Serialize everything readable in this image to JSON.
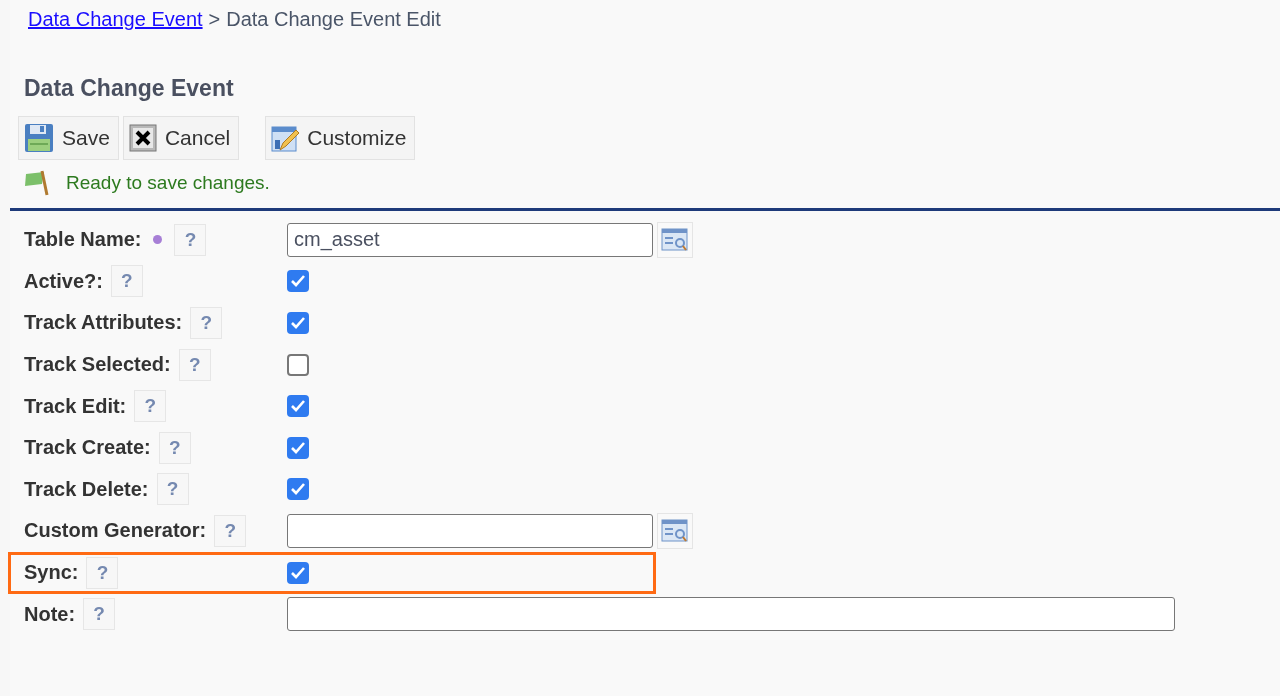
{
  "breadcrumb": {
    "link": "Data Change Event",
    "separator": ">",
    "current": "Data Change Event Edit"
  },
  "heading": "Data Change Event",
  "toolbar": [
    {
      "label": "Save",
      "kind": "save"
    },
    {
      "label": "Cancel",
      "kind": "cancel"
    },
    {
      "label": "Customize",
      "kind": "customize"
    }
  ],
  "status_message": "Ready to save changes.",
  "fields": [
    {
      "label": "Table Name:",
      "help": "?",
      "required": true,
      "kind": "text",
      "value": "cm_asset",
      "lookup": true,
      "highlighted": false
    },
    {
      "label": "Active?:",
      "help": "?",
      "required": false,
      "kind": "checkbox",
      "checked": true,
      "highlighted": false
    },
    {
      "label": "Track Attributes:",
      "help": "?",
      "required": false,
      "kind": "checkbox",
      "checked": true,
      "highlighted": false
    },
    {
      "label": "Track Selected:",
      "help": "?",
      "required": false,
      "kind": "checkbox",
      "checked": false,
      "highlighted": false
    },
    {
      "label": "Track Edit:",
      "help": "?",
      "required": false,
      "kind": "checkbox",
      "checked": true,
      "highlighted": false
    },
    {
      "label": "Track Create:",
      "help": "?",
      "required": false,
      "kind": "checkbox",
      "checked": true,
      "highlighted": false
    },
    {
      "label": "Track Delete:",
      "help": "?",
      "required": false,
      "kind": "checkbox",
      "checked": true,
      "highlighted": false
    },
    {
      "label": "Custom Generator:",
      "help": "?",
      "required": false,
      "kind": "text",
      "lookup": true,
      "highlighted": false
    },
    {
      "label": "Sync:",
      "help": "?",
      "required": false,
      "kind": "checkbox",
      "checked": true,
      "highlighted": true
    },
    {
      "label": "Note:",
      "help": "?",
      "required": false,
      "kind": "longtext",
      "lookup": false,
      "highlighted": false
    }
  ]
}
